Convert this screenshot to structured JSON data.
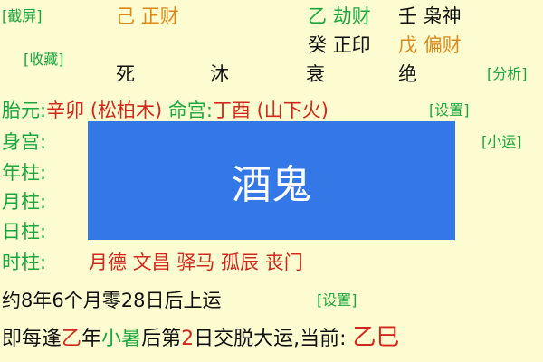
{
  "buttons": {
    "screenshot": "[截屏]",
    "favorite": "[收藏]",
    "analyze": "[分析]",
    "minor_luck": "[小运]",
    "settings1": "[设置]",
    "settings2": "[设置]"
  },
  "top": {
    "hidden_stem_1": {
      "char": "己",
      "god": "正财"
    },
    "hidden_stem_2": {
      "char": "乙",
      "god": "劫财"
    },
    "hidden_stem_3": {
      "char": "壬",
      "god": "枭神"
    },
    "hidden_stem_4": {
      "char": "癸",
      "god": "正印"
    },
    "hidden_stem_5": {
      "char": "戊",
      "god": "偏财"
    }
  },
  "phases": [
    "死",
    "沐",
    "衰",
    "绝"
  ],
  "taiyuan": {
    "label": "胎元:",
    "value": "辛卯 (松柏木)",
    "minggong_label": "命宫:",
    "minggong_value": "丁酉 (山下火)"
  },
  "pillars": {
    "shengong": "身宫:",
    "year": "年柱:",
    "month": "月柱:",
    "day": "日柱:",
    "hour": "时柱:"
  },
  "overlay_text": "酒鬼",
  "stars": "月德 文昌 驿马 孤辰 丧门",
  "luck": {
    "start_text": "约8年6个月零28日后上运",
    "line2_a": "即每逢",
    "line2_stem": "乙",
    "line2_b": "年",
    "line2_term": "小暑",
    "line2_c": "后第",
    "line2_num": "2",
    "line2_d": "日交脱大运,当前: ",
    "current": "乙巳"
  }
}
